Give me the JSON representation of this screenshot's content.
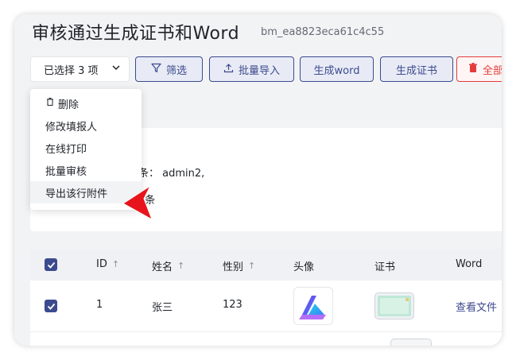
{
  "header": {
    "title": "审核通过生成证书和Word",
    "subtitle": "bm_ea8823eca61c4c55"
  },
  "toolbar": {
    "selected_label": "已选择 3 项",
    "filter_label": "筛选",
    "import_label": "批量导入",
    "word_label": "生成word",
    "cert_label": "生成证书",
    "all_label": "全部"
  },
  "dropdown": {
    "items": [
      {
        "label": "删除",
        "icon": "trash-icon"
      },
      {
        "label": "修改填报人"
      },
      {
        "label": "在线打印"
      },
      {
        "label": "批量审核"
      },
      {
        "label": "导出该行附件"
      }
    ]
  },
  "info": {
    "line1": "条： admin2,",
    "line2": "1条"
  },
  "table": {
    "columns": [
      {
        "label": "ID",
        "sortable": true
      },
      {
        "label": "姓名",
        "sortable": true
      },
      {
        "label": "性别",
        "sortable": true
      },
      {
        "label": "头像"
      },
      {
        "label": "证书"
      },
      {
        "label": "Word"
      }
    ],
    "rows": [
      {
        "checked": true,
        "id": "1",
        "name": "张三",
        "gender": "123",
        "word": "查看文件"
      }
    ]
  },
  "colors": {
    "accent": "#3c4a8e",
    "danger": "#e23c3c",
    "background": "#f2f3f5"
  }
}
